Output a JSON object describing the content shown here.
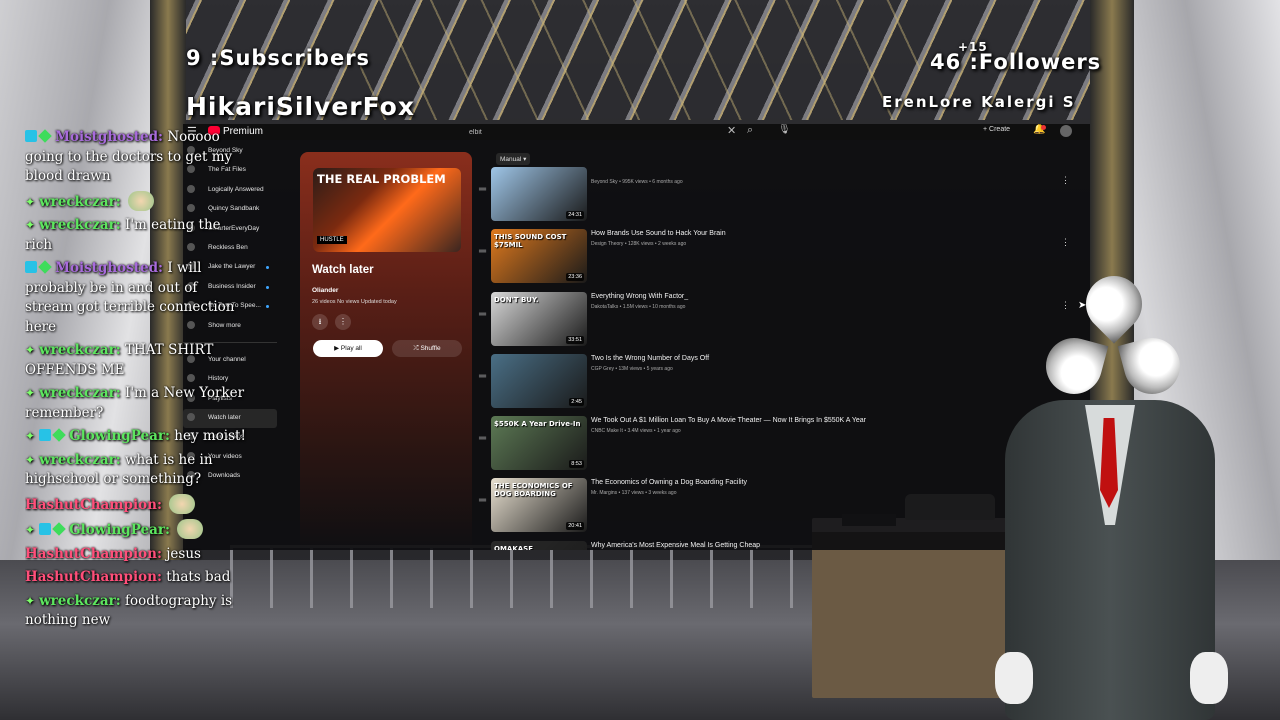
{
  "overlay": {
    "subscribers": "9 :Subscribers",
    "streamer": "HikariSilverFox",
    "follow_gain": "+15",
    "followers": "46 :Followers",
    "ticker": "ErenLore   Kalergi   S"
  },
  "chat": [
    {
      "user": "Moistghosted:",
      "text": "Nooooo going to the doctors to get my blood drawn",
      "color": "#a86bdb"
    },
    {
      "user": "wreckczar:",
      "text": "",
      "color": "#5de65f"
    },
    {
      "user": "wreckczar:",
      "text": "I'm eating the rich",
      "color": "#5de65f"
    },
    {
      "user": "Moistghosted:",
      "text": "I will probably be in and out of stream got terrible connection here",
      "color": "#a86bdb"
    },
    {
      "user": "wreckczar:",
      "text": "THAT SHIRT OFFENDS ME",
      "color": "#5de65f"
    },
    {
      "user": "wreckczar:",
      "text": "I'm a New Yorker remember?",
      "color": "#5de65f"
    },
    {
      "user": "GlowingPear:",
      "text": "hey moist!",
      "color": "#5de65f"
    },
    {
      "user": "wreckczar:",
      "text": "what is he in highschool or something?",
      "color": "#5de65f"
    },
    {
      "user": "HashutChampion:",
      "text": "",
      "color": "#ff4f7a"
    },
    {
      "user": "GlowingPear:",
      "text": "",
      "color": "#5de65f"
    },
    {
      "user": "HashutChampion:",
      "text": "jesus",
      "color": "#ff4f7a"
    },
    {
      "user": "HashutChampion:",
      "text": "thats bad",
      "color": "#ff4f7a"
    },
    {
      "user": "wreckczar:",
      "text": "foodtography is nothing new",
      "color": "#5de65f"
    }
  ],
  "youtube": {
    "brand": "Premium",
    "search_value": "elbit",
    "create_label": "Create",
    "sidebar": [
      {
        "label": "Beyond Sky",
        "dot": false
      },
      {
        "label": "The Fat Files",
        "dot": false
      },
      {
        "label": "Logically Answered",
        "dot": false
      },
      {
        "label": "Quincy Sandbank",
        "dot": false
      },
      {
        "label": "SmarterEveryDay",
        "dot": false
      },
      {
        "label": "Reckless Ben",
        "dot": false
      },
      {
        "label": "Jake the Lawyer",
        "dot": true
      },
      {
        "label": "Business Insider",
        "dot": true
      },
      {
        "label": "No Text To Spee...",
        "dot": true
      },
      {
        "label": "Show more",
        "dot": false
      }
    ],
    "you_section": [
      {
        "label": "Your channel",
        "active": false
      },
      {
        "label": "History",
        "active": false
      },
      {
        "label": "Playlists",
        "active": false
      },
      {
        "label": "Watch later",
        "active": true
      },
      {
        "label": "Liked videos",
        "active": false
      },
      {
        "label": "Your videos",
        "active": false
      },
      {
        "label": "Downloads",
        "active": false
      }
    ],
    "playlist": {
      "thumb_title": "THE REAL PROBLEM",
      "thumb_tag": "HUSTLE",
      "title": "Watch later",
      "owner": "Oliander",
      "meta": "26 videos  No views  Updated today",
      "play_all": "Play all",
      "shuffle": "Shuffle"
    },
    "sort_label": "Manual",
    "videos": [
      {
        "title": "",
        "meta": "Beyond Sky • 995K views • 6 months ago",
        "duration": "24:31",
        "thumb_text": "",
        "thumb_color": "#9fc6e8"
      },
      {
        "title": "How Brands Use Sound to Hack Your Brain",
        "meta": "Design Theory • 128K views • 2 weeks ago",
        "duration": "23:36",
        "thumb_text": "THIS SOUND COST $75MIL",
        "thumb_color": "#e07a1e"
      },
      {
        "title": "Everything Wrong With Factor_",
        "meta": "DakotaTalks • 1.5M views • 10 months ago",
        "duration": "33:51",
        "thumb_text": "DON'T BUY.",
        "thumb_color": "#d8d8d8"
      },
      {
        "title": "Two Is the Wrong Number of Days Off",
        "meta": "CGP Grey • 13M views • 5 years ago",
        "duration": "2:45",
        "thumb_text": "",
        "thumb_color": "#4a6f86"
      },
      {
        "title": "We Took Out A $1 Million Loan To Buy A Movie Theater — Now It Brings In $550K A Year",
        "meta": "CNBC Make It • 3.4M views • 1 year ago",
        "duration": "8:53",
        "thumb_text": "$550K A Year Drive-In",
        "thumb_color": "#5d7a55"
      },
      {
        "title": "The Economics of Owning a Dog Boarding Facility",
        "meta": "Mr. Margins • 137 views • 3 weeks ago",
        "duration": "20:41",
        "thumb_text": "THE ECONOMICS OF DOG BOARDING",
        "thumb_color": "#e8e0d0"
      },
      {
        "title": "Why America's Most Expensive Meal Is Getting Cheap",
        "meta": "",
        "duration": "",
        "thumb_text": "OMAKASE",
        "thumb_color": "#2a2a2a"
      }
    ]
  }
}
